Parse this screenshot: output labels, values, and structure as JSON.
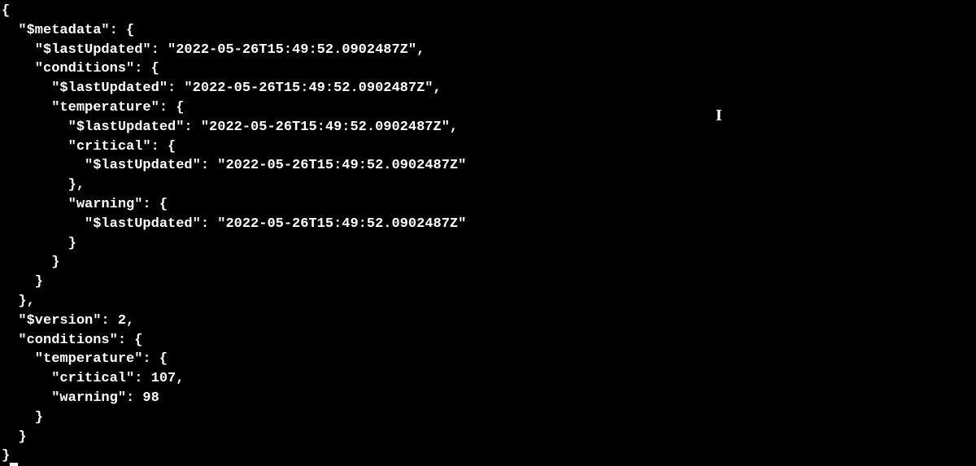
{
  "json": {
    "l1": "{",
    "l2": "  \"$metadata\": {",
    "l3": "    \"$lastUpdated\": \"2022-05-26T15:49:52.0902487Z\",",
    "l4": "    \"conditions\": {",
    "l5": "      \"$lastUpdated\": \"2022-05-26T15:49:52.0902487Z\",",
    "l6": "      \"temperature\": {",
    "l7": "        \"$lastUpdated\": \"2022-05-26T15:49:52.0902487Z\",",
    "l8": "        \"critical\": {",
    "l9": "          \"$lastUpdated\": \"2022-05-26T15:49:52.0902487Z\"",
    "l10": "        },",
    "l11": "        \"warning\": {",
    "l12": "          \"$lastUpdated\": \"2022-05-26T15:49:52.0902487Z\"",
    "l13": "        }",
    "l14": "      }",
    "l15": "    }",
    "l16": "  },",
    "l17": "  \"$version\": 2,",
    "l18": "  \"conditions\": {",
    "l19": "    \"temperature\": {",
    "l20": "      \"critical\": 107,",
    "l21": "      \"warning\": 98",
    "l22": "    }",
    "l23": "  }",
    "l24": "}"
  },
  "cursor": {
    "glyph": "I"
  }
}
